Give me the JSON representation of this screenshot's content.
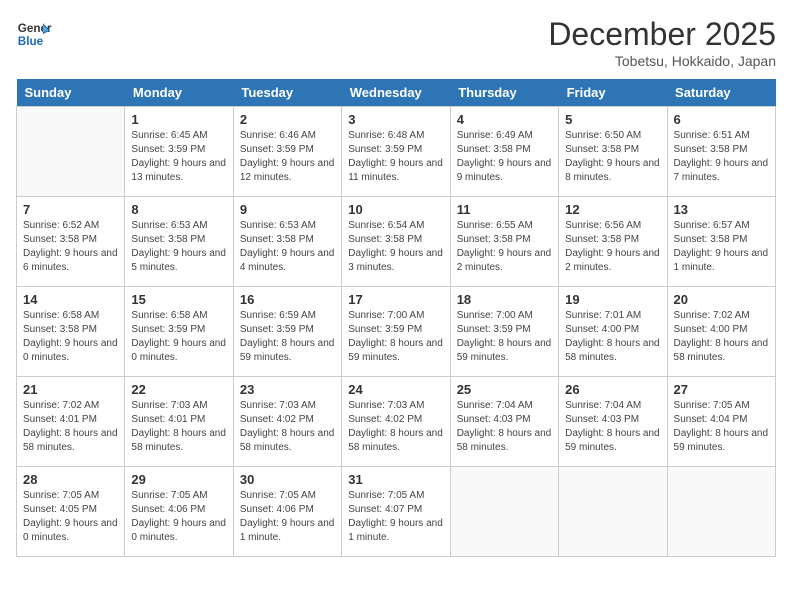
{
  "logo": {
    "line1": "General",
    "line2": "Blue"
  },
  "title": "December 2025",
  "subtitle": "Tobetsu, Hokkaido, Japan",
  "headers": [
    "Sunday",
    "Monday",
    "Tuesday",
    "Wednesday",
    "Thursday",
    "Friday",
    "Saturday"
  ],
  "weeks": [
    [
      {
        "day": null
      },
      {
        "day": "1",
        "sunrise": "6:45 AM",
        "sunset": "3:59 PM",
        "daylight": "9 hours and 13 minutes."
      },
      {
        "day": "2",
        "sunrise": "6:46 AM",
        "sunset": "3:59 PM",
        "daylight": "9 hours and 12 minutes."
      },
      {
        "day": "3",
        "sunrise": "6:48 AM",
        "sunset": "3:59 PM",
        "daylight": "9 hours and 11 minutes."
      },
      {
        "day": "4",
        "sunrise": "6:49 AM",
        "sunset": "3:58 PM",
        "daylight": "9 hours and 9 minutes."
      },
      {
        "day": "5",
        "sunrise": "6:50 AM",
        "sunset": "3:58 PM",
        "daylight": "9 hours and 8 minutes."
      },
      {
        "day": "6",
        "sunrise": "6:51 AM",
        "sunset": "3:58 PM",
        "daylight": "9 hours and 7 minutes."
      }
    ],
    [
      {
        "day": "7",
        "sunrise": "6:52 AM",
        "sunset": "3:58 PM",
        "daylight": "9 hours and 6 minutes."
      },
      {
        "day": "8",
        "sunrise": "6:53 AM",
        "sunset": "3:58 PM",
        "daylight": "9 hours and 5 minutes."
      },
      {
        "day": "9",
        "sunrise": "6:53 AM",
        "sunset": "3:58 PM",
        "daylight": "9 hours and 4 minutes."
      },
      {
        "day": "10",
        "sunrise": "6:54 AM",
        "sunset": "3:58 PM",
        "daylight": "9 hours and 3 minutes."
      },
      {
        "day": "11",
        "sunrise": "6:55 AM",
        "sunset": "3:58 PM",
        "daylight": "9 hours and 2 minutes."
      },
      {
        "day": "12",
        "sunrise": "6:56 AM",
        "sunset": "3:58 PM",
        "daylight": "9 hours and 2 minutes."
      },
      {
        "day": "13",
        "sunrise": "6:57 AM",
        "sunset": "3:58 PM",
        "daylight": "9 hours and 1 minute."
      }
    ],
    [
      {
        "day": "14",
        "sunrise": "6:58 AM",
        "sunset": "3:58 PM",
        "daylight": "9 hours and 0 minutes."
      },
      {
        "day": "15",
        "sunrise": "6:58 AM",
        "sunset": "3:59 PM",
        "daylight": "9 hours and 0 minutes."
      },
      {
        "day": "16",
        "sunrise": "6:59 AM",
        "sunset": "3:59 PM",
        "daylight": "8 hours and 59 minutes."
      },
      {
        "day": "17",
        "sunrise": "7:00 AM",
        "sunset": "3:59 PM",
        "daylight": "8 hours and 59 minutes."
      },
      {
        "day": "18",
        "sunrise": "7:00 AM",
        "sunset": "3:59 PM",
        "daylight": "8 hours and 59 minutes."
      },
      {
        "day": "19",
        "sunrise": "7:01 AM",
        "sunset": "4:00 PM",
        "daylight": "8 hours and 58 minutes."
      },
      {
        "day": "20",
        "sunrise": "7:02 AM",
        "sunset": "4:00 PM",
        "daylight": "8 hours and 58 minutes."
      }
    ],
    [
      {
        "day": "21",
        "sunrise": "7:02 AM",
        "sunset": "4:01 PM",
        "daylight": "8 hours and 58 minutes."
      },
      {
        "day": "22",
        "sunrise": "7:03 AM",
        "sunset": "4:01 PM",
        "daylight": "8 hours and 58 minutes."
      },
      {
        "day": "23",
        "sunrise": "7:03 AM",
        "sunset": "4:02 PM",
        "daylight": "8 hours and 58 minutes."
      },
      {
        "day": "24",
        "sunrise": "7:03 AM",
        "sunset": "4:02 PM",
        "daylight": "8 hours and 58 minutes."
      },
      {
        "day": "25",
        "sunrise": "7:04 AM",
        "sunset": "4:03 PM",
        "daylight": "8 hours and 58 minutes."
      },
      {
        "day": "26",
        "sunrise": "7:04 AM",
        "sunset": "4:03 PM",
        "daylight": "8 hours and 59 minutes."
      },
      {
        "day": "27",
        "sunrise": "7:05 AM",
        "sunset": "4:04 PM",
        "daylight": "8 hours and 59 minutes."
      }
    ],
    [
      {
        "day": "28",
        "sunrise": "7:05 AM",
        "sunset": "4:05 PM",
        "daylight": "9 hours and 0 minutes."
      },
      {
        "day": "29",
        "sunrise": "7:05 AM",
        "sunset": "4:06 PM",
        "daylight": "9 hours and 0 minutes."
      },
      {
        "day": "30",
        "sunrise": "7:05 AM",
        "sunset": "4:06 PM",
        "daylight": "9 hours and 1 minute."
      },
      {
        "day": "31",
        "sunrise": "7:05 AM",
        "sunset": "4:07 PM",
        "daylight": "9 hours and 1 minute."
      },
      {
        "day": null
      },
      {
        "day": null
      },
      {
        "day": null
      }
    ]
  ]
}
